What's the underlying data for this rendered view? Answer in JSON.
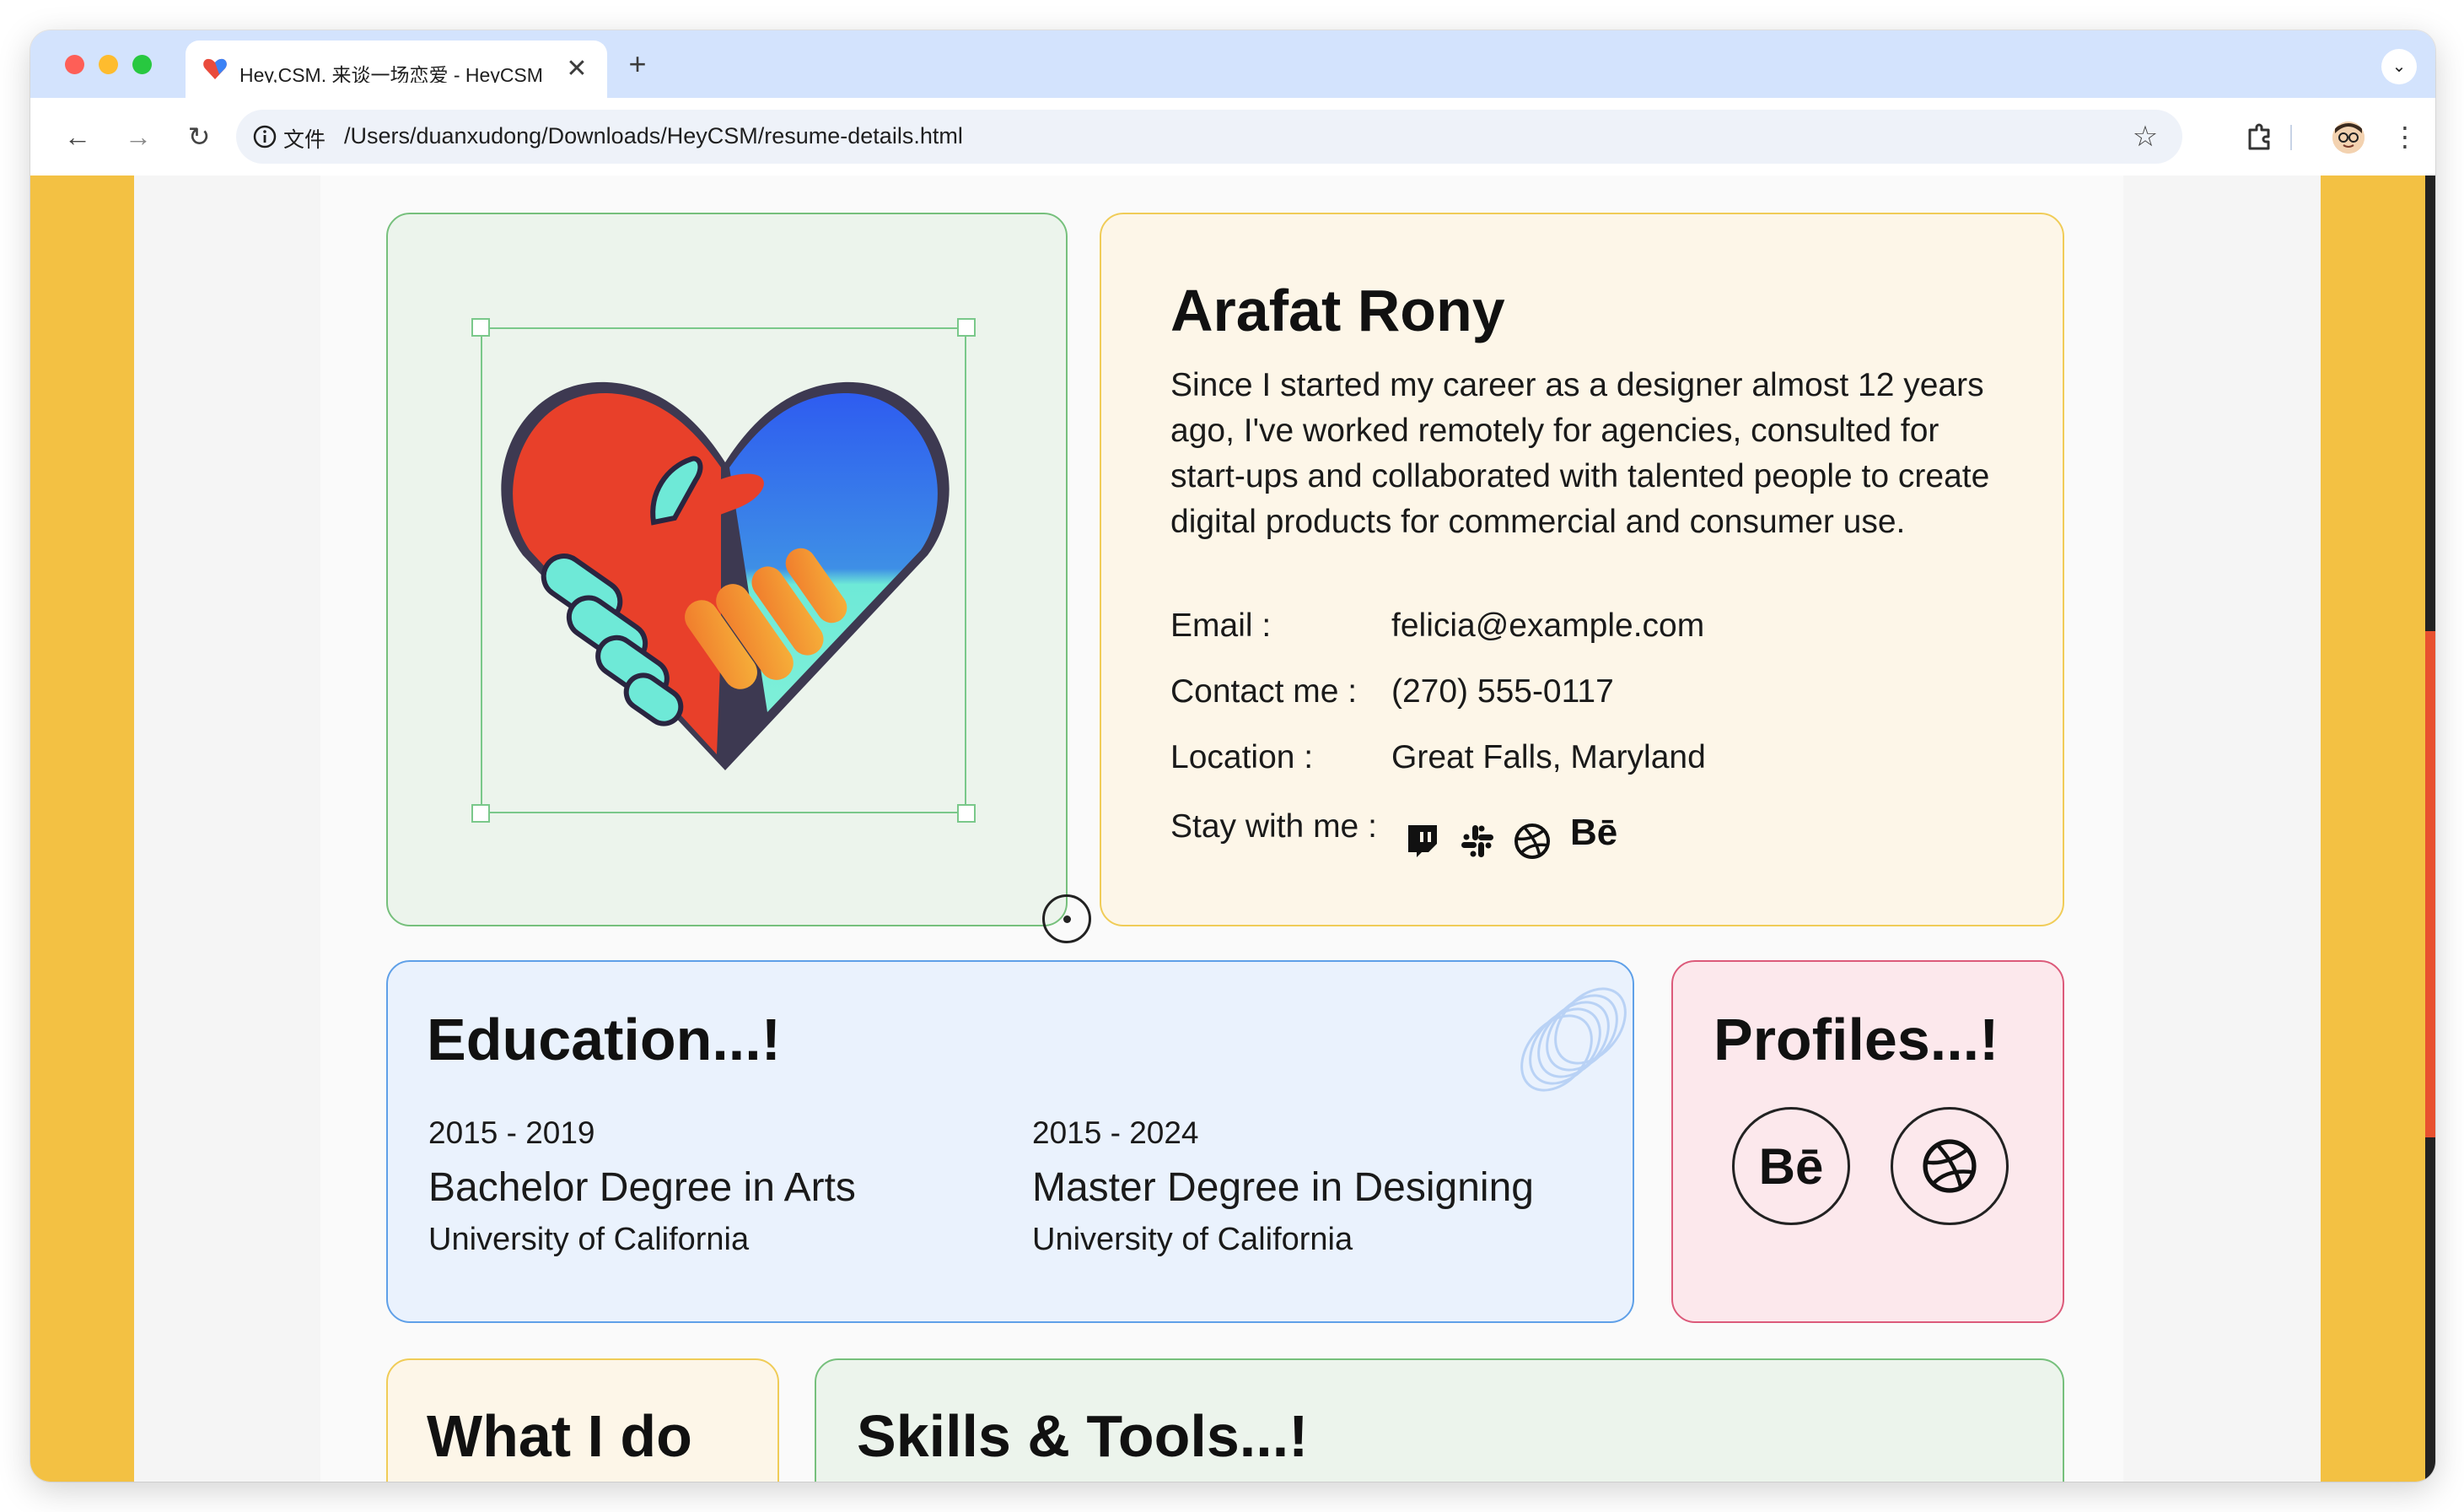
{
  "browser": {
    "tab_title": "Hey,CSM. 来谈一场恋爱 - HeyCSM",
    "tab_close": "✕",
    "new_tab": "+",
    "tab_dropdown": "⌄",
    "back": "←",
    "forward": "→",
    "reload": "↻",
    "url_chip": "文件",
    "url": "/Users/duanxudong/Downloads/HeyCSM/resume-details.html",
    "star": "☆",
    "more": "⋮"
  },
  "profile": {
    "name": "Arafat Rony",
    "bio": "Since I started my career as a designer almost 12 years ago, I've worked remotely for agencies, consulted for start-ups and collaborated with talented people to create digital products for commercial and consumer use.",
    "email_label": "Email :",
    "email": "felicia@example.com",
    "contact_label": "Contact me :",
    "contact": "(270) 555-0117",
    "location_label": "Location :",
    "location": "Great Falls, Maryland",
    "social_label": "Stay with me :",
    "behance": "Bē"
  },
  "education": {
    "title": "Education...!",
    "items": [
      {
        "years": "2015 - 2019",
        "degree": "Bachelor Degree in Arts",
        "school": "University of California"
      },
      {
        "years": "2015 - 2024",
        "degree": "Master Degree in Designing",
        "school": "University of California"
      }
    ]
  },
  "profiles": {
    "title": "Profiles...!",
    "behance": "Bē"
  },
  "what_i_do": {
    "title": "What I do"
  },
  "skills": {
    "title": "Skills & Tools...!"
  },
  "colors": {
    "accent_yellow": "#f3c143",
    "green_card": "#ecf4ec",
    "blue_card": "#eaf2fd",
    "pink_card": "#fce8ec",
    "cream_card": "#fdf6e8"
  }
}
